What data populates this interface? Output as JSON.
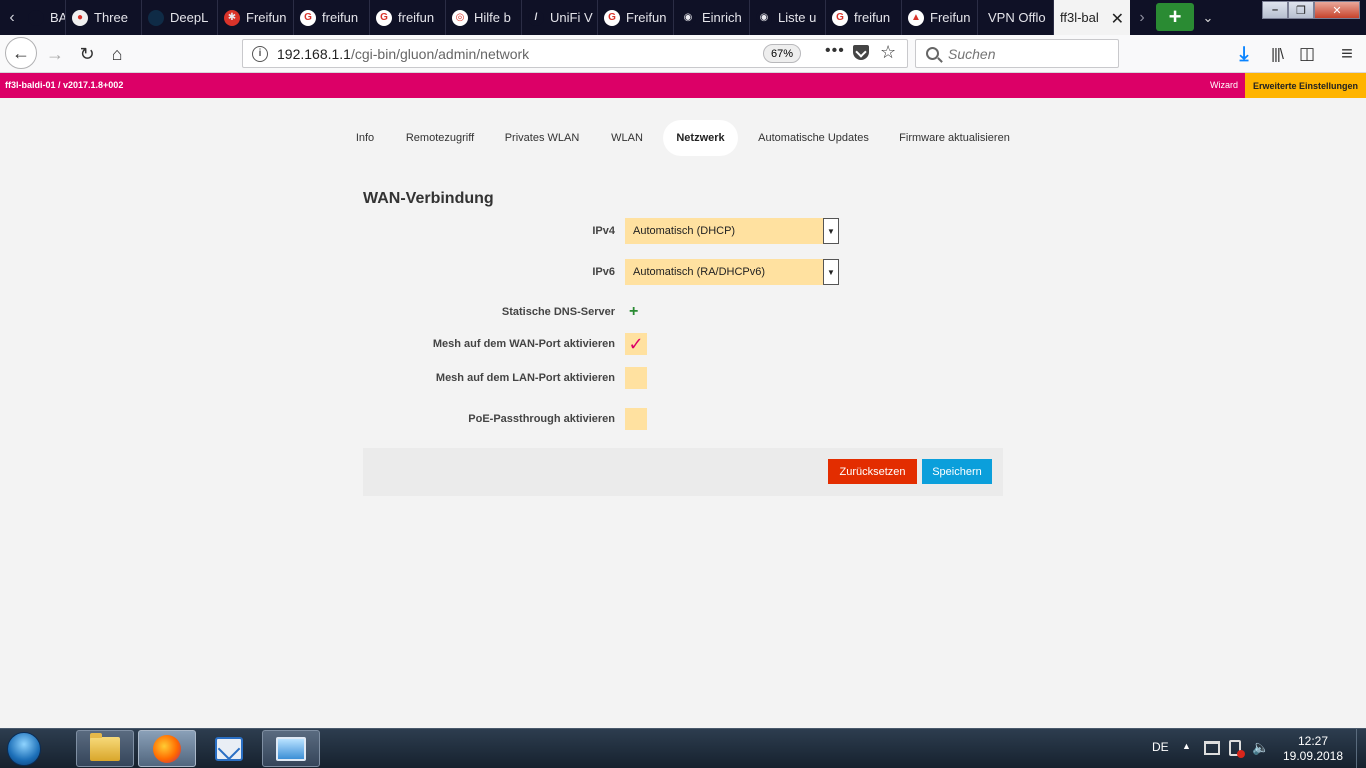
{
  "browser": {
    "tabs": [
      {
        "label": "BAPI",
        "fav_bg": "#0f1126",
        "fav_glyph": ""
      },
      {
        "label": "Three",
        "fav_bg": "#f0f0f0",
        "fav_glyph": "●"
      },
      {
        "label": "DeepL",
        "fav_bg": "#0f2b46",
        "fav_glyph": ""
      },
      {
        "label": "Freifun",
        "fav_bg": "#d9332a",
        "fav_glyph": "✱"
      },
      {
        "label": "freifun",
        "fav_bg": "#ffffff",
        "fav_glyph": "G"
      },
      {
        "label": "freifun",
        "fav_bg": "#ffffff",
        "fav_glyph": "G"
      },
      {
        "label": "Hilfe b",
        "fav_bg": "#ffffff",
        "fav_glyph": "◎"
      },
      {
        "label": "UniFi V",
        "fav_bg": "#0f1126",
        "fav_glyph": "/"
      },
      {
        "label": "Freifun",
        "fav_bg": "#ffffff",
        "fav_glyph": "G"
      },
      {
        "label": "Einrich",
        "fav_bg": "#0f1126",
        "fav_glyph": "◉"
      },
      {
        "label": "Liste u",
        "fav_bg": "#0f1126",
        "fav_glyph": "◉"
      },
      {
        "label": "freifun",
        "fav_bg": "#ffffff",
        "fav_glyph": "G"
      },
      {
        "label": "Freifun",
        "fav_bg": "#ffffff",
        "fav_glyph": "▲"
      },
      {
        "label": "VPN Offlo",
        "fav_bg": "",
        "fav_glyph": ""
      }
    ],
    "active_tab": "ff3l-bal",
    "url_host": "192.168.1.1",
    "url_path": "/cgi-bin/gluon/admin/network",
    "zoom": "67%",
    "search_placeholder": "Suchen"
  },
  "page": {
    "host_version": "ff3l-baldi-01 / v2017.1.8+002",
    "wizard_link": "Wizard",
    "advanced_link": "Erweiterte Einstellungen",
    "nav": [
      {
        "label": "Info"
      },
      {
        "label": "Remotezugriff"
      },
      {
        "label": "Privates WLAN"
      },
      {
        "label": "WLAN"
      },
      {
        "label": "Netzwerk"
      },
      {
        "label": "Automatische Updates"
      },
      {
        "label": "Firmware aktualisieren"
      }
    ],
    "active_nav": "Netzwerk",
    "form": {
      "title": "WAN-Verbindung",
      "ipv4_label": "IPv4",
      "ipv4_value": "Automatisch (DHCP)",
      "ipv6_label": "IPv6",
      "ipv6_value": "Automatisch (RA/DHCPv6)",
      "dns_label": "Statische DNS-Server",
      "mesh_wan_label": "Mesh auf dem WAN-Port aktivieren",
      "mesh_wan_checked": true,
      "mesh_lan_label": "Mesh auf dem LAN-Port aktivieren",
      "mesh_lan_checked": false,
      "poe_label": "PoE-Passthrough aktivieren",
      "poe_checked": false,
      "reset_label": "Zurücksetzen",
      "save_label": "Speichern"
    }
  },
  "taskbar": {
    "language": "DE",
    "time": "12:27",
    "date": "19.09.2018"
  },
  "colors": {
    "brand_magenta": "#dc0067",
    "advanced_yellow": "#ffb400",
    "field_bg": "#ffe1a0",
    "reset_red": "#e32d00",
    "save_blue": "#0b9fdb"
  }
}
